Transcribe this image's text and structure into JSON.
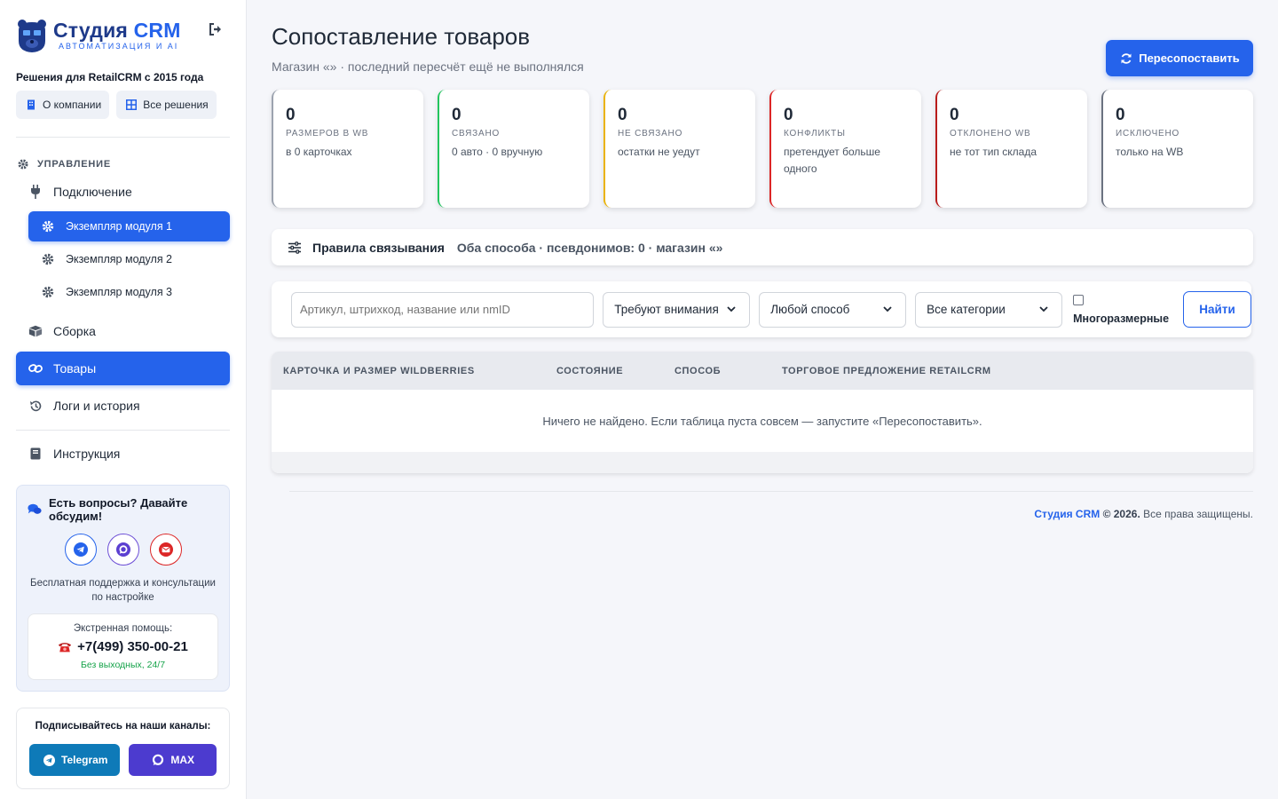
{
  "sidebar": {
    "brand_title_main": "Студия",
    "brand_title_accent": "CRM",
    "brand_subtitle": "АВТОМАТИЗАЦИЯ И AI",
    "tagline": "Решения для RetailCRM с 2015 года",
    "quick_links": [
      "О компании",
      "Все решения"
    ],
    "section_title": "УПРАВЛЕНИЕ",
    "nav": {
      "connection": "Подключение",
      "modules": [
        "Экземпляр модуля 1",
        "Экземпляр модуля 2",
        "Экземпляр модуля 3"
      ],
      "assembly": "Сборка",
      "products": "Товары",
      "logs": "Логи и история",
      "docs": "Инструкция"
    },
    "support": {
      "title": "Есть вопросы? Давайте обсудим!",
      "text": "Бесплатная поддержка и консультации по настройке",
      "emergency_label": "Экстренная помощь:",
      "phone": "+7(499) 350-00-21",
      "availability": "Без выходных, 24/7"
    },
    "subscribe": {
      "title": "Подписывайтесь на наши каналы:",
      "telegram": "Telegram",
      "max": "MAX"
    }
  },
  "main": {
    "title": "Сопоставление товаров",
    "subtitle": "Магазин «» · последний пересчёт ещё не выполнялся",
    "resync_button": "Пересопоставить",
    "stats": [
      {
        "value": "0",
        "label": "РАЗМЕРОВ В WB",
        "note": "в 0 карточках",
        "color": "#9ca3af"
      },
      {
        "value": "0",
        "label": "СВЯЗАНО",
        "note": "0 авто · 0 вручную",
        "color": "#22c55e"
      },
      {
        "value": "0",
        "label": "НЕ СВЯЗАНО",
        "note": "остатки не уедут",
        "color": "#eab308"
      },
      {
        "value": "0",
        "label": "КОНФЛИКТЫ",
        "note": "претендует больше одного",
        "color": "#dc2626"
      },
      {
        "value": "0",
        "label": "ОТКЛОНЕНО WB",
        "note": "не тот тип склада",
        "color": "#b91c1c"
      },
      {
        "value": "0",
        "label": "ИСКЛЮЧЕНО",
        "note": "только на WB",
        "color": "#6b7280"
      }
    ],
    "rules": {
      "title": "Правила связывания",
      "info": "Оба способа · псевдонимов: 0 · магазин «»"
    },
    "filters": {
      "search_placeholder": "Артикул, штрихкод, название или nmID",
      "status": "Требуют внимания",
      "method": "Любой способ",
      "category": "Все категории",
      "multisize": "Многоразмерные",
      "find": "Найти"
    },
    "table": {
      "columns": [
        "КАРТОЧКА И РАЗМЕР WILDBERRIES",
        "СОСТОЯНИЕ",
        "СПОСОБ",
        "ТОРГОВОЕ ПРЕДЛОЖЕНИЕ RETAILCRM"
      ],
      "empty": "Ничего не найдено. Если таблица пуста совсем — запустите «Пересопоставить»."
    },
    "footer": {
      "brand": "Студия CRM",
      "year": "© 2026.",
      "rights": "Все права защищены."
    }
  },
  "colors": {
    "accent": "#2563eb",
    "brand_dark": "#1e3a8a"
  }
}
